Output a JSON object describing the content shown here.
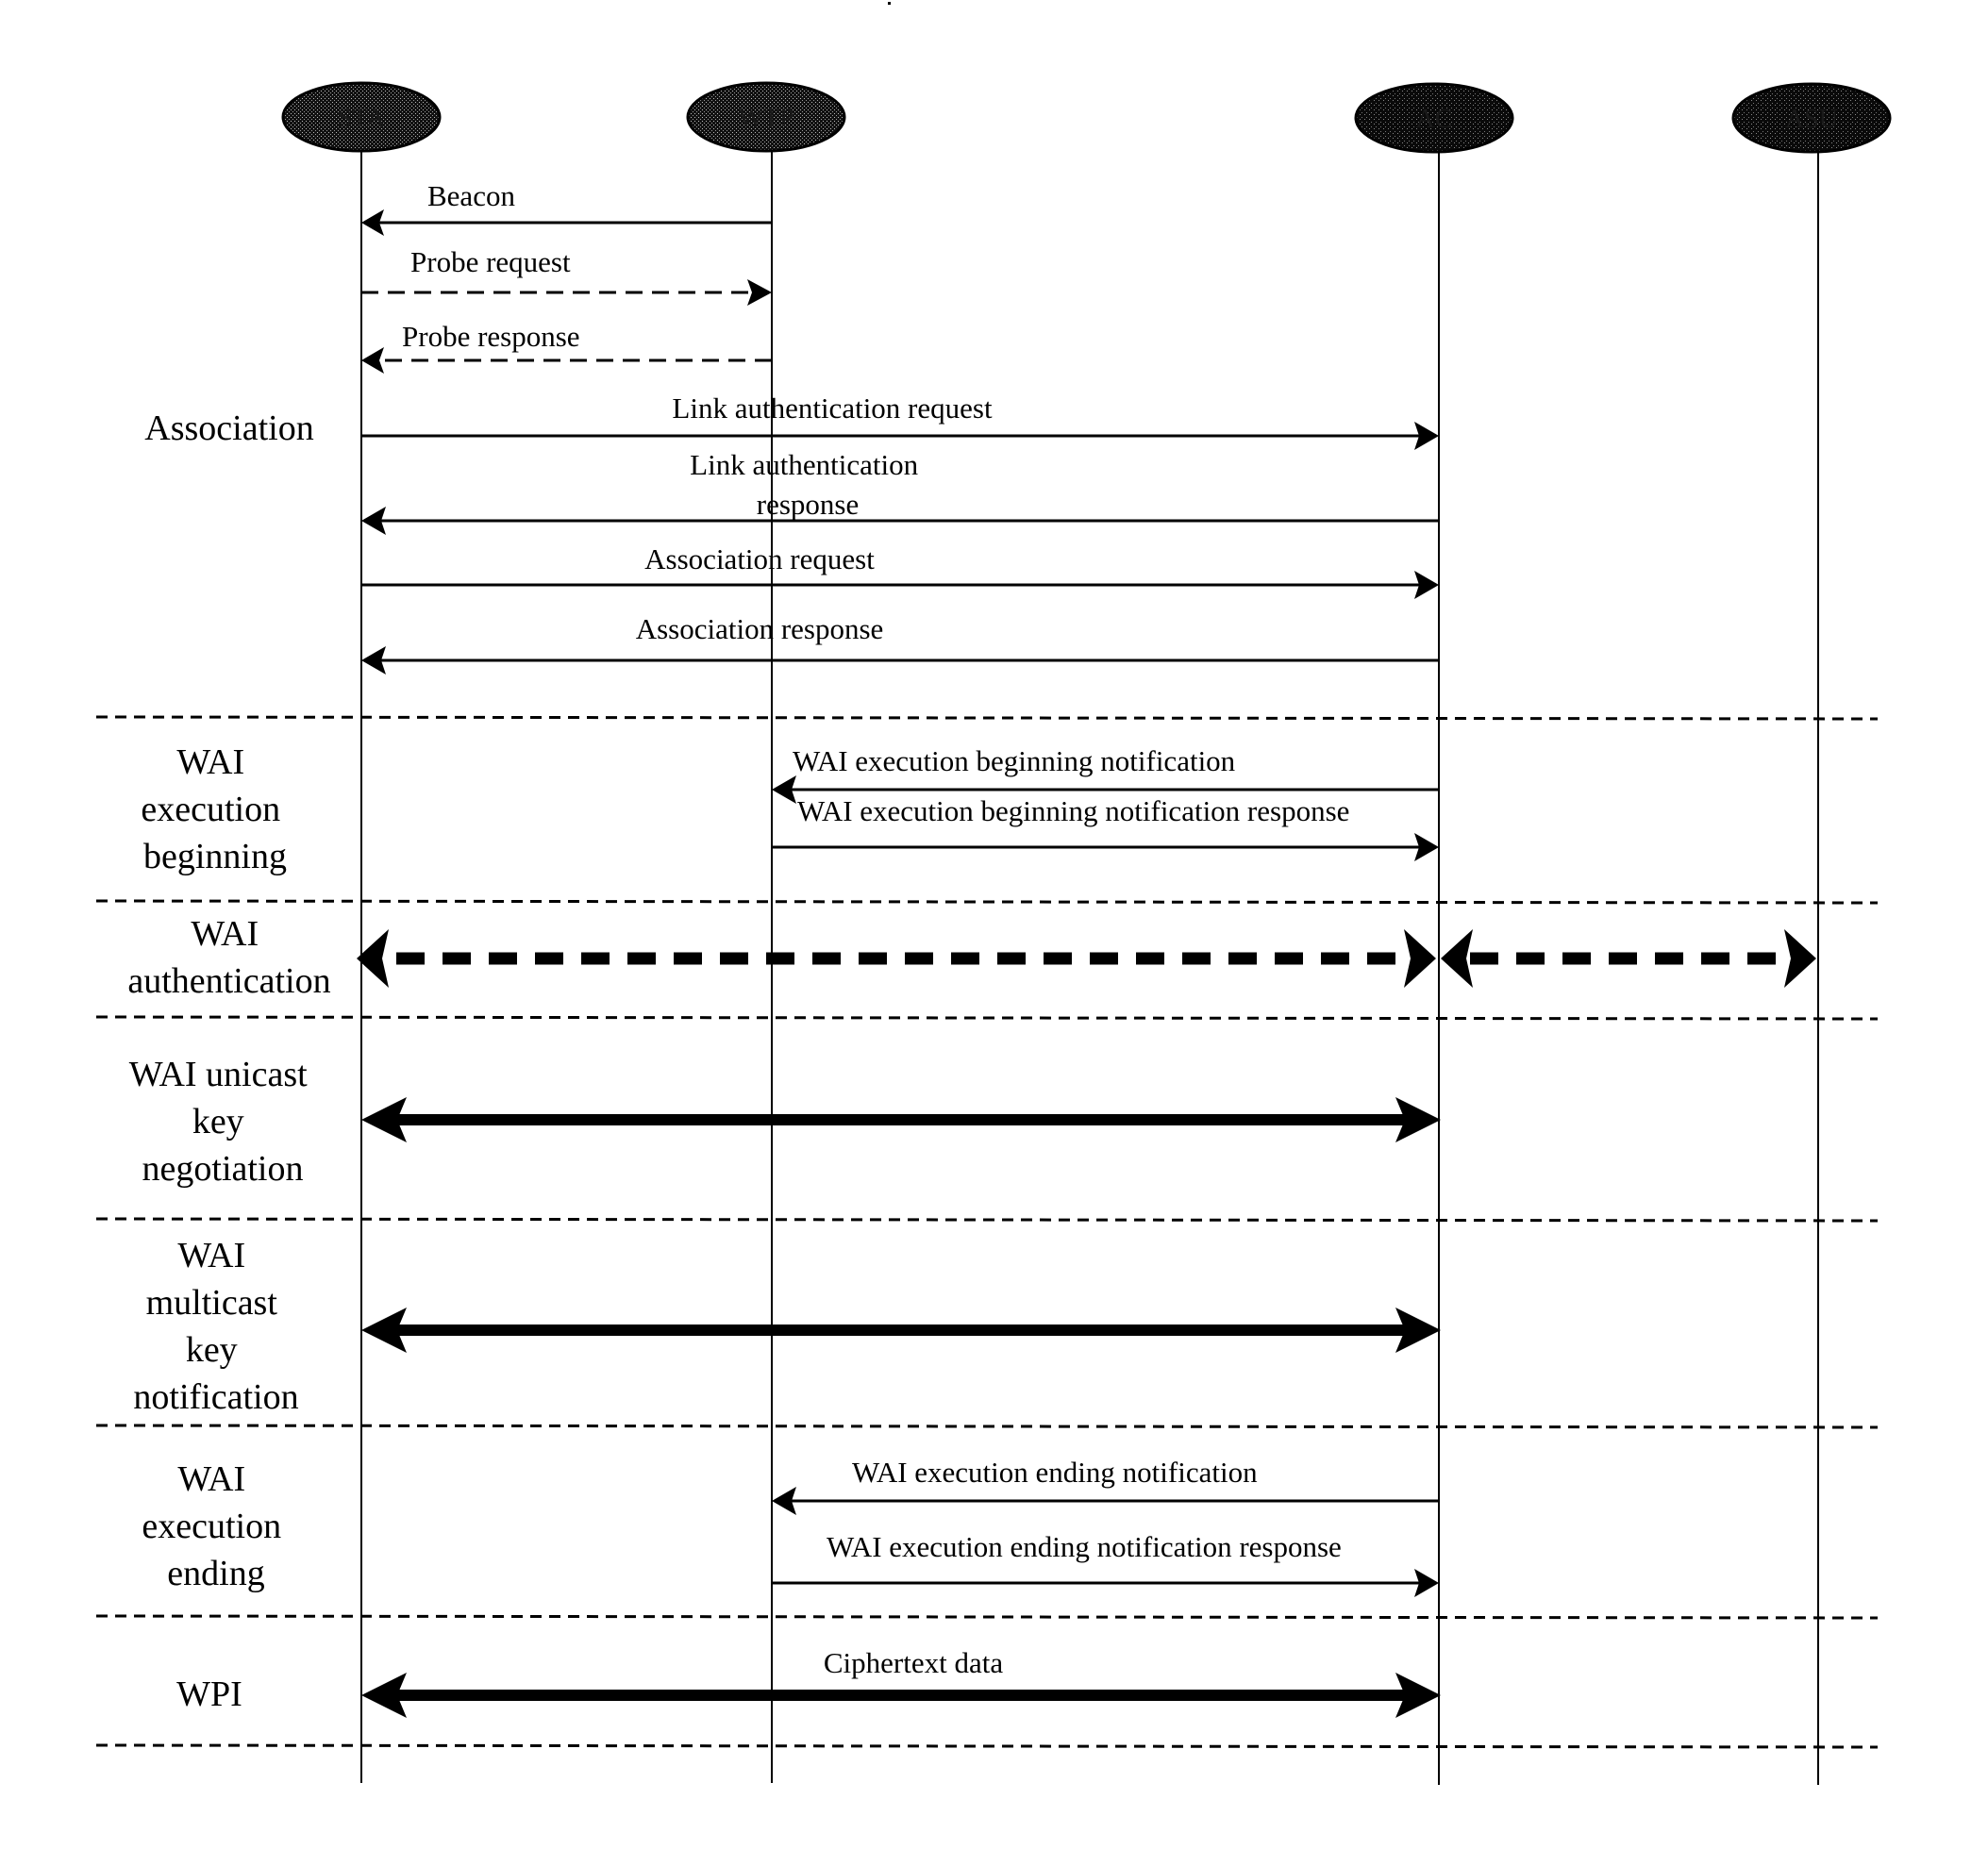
{
  "diagram": {
    "type": "sequence",
    "entities": [
      {
        "id": "sta",
        "label": "STA"
      },
      {
        "id": "wtp",
        "label": "WTP"
      },
      {
        "id": "ac",
        "label": "AC"
      },
      {
        "id": "asu",
        "label": "ASU"
      }
    ],
    "phases": [
      {
        "id": "association",
        "lines": [
          "Association"
        ]
      },
      {
        "id": "wai-execution-beginning",
        "lines": [
          "WAI",
          "execution",
          "beginning"
        ]
      },
      {
        "id": "wai-authentication",
        "lines": [
          "WAI",
          "authentication"
        ]
      },
      {
        "id": "wai-unicast-key-negotiation",
        "lines": [
          "WAI unicast",
          "key",
          "negotiation"
        ]
      },
      {
        "id": "wai-multicast-key-notification",
        "lines": [
          "WAI",
          "multicast",
          "key",
          "notification"
        ]
      },
      {
        "id": "wai-execution-ending",
        "lines": [
          "WAI",
          "execution",
          "ending"
        ]
      },
      {
        "id": "wpi",
        "lines": [
          "WPI"
        ]
      }
    ],
    "messages": [
      {
        "id": "beacon",
        "label": [
          "Beacon"
        ],
        "from": "wtp",
        "to": "sta",
        "style": "solid"
      },
      {
        "id": "probe-request",
        "label": [
          "Probe request"
        ],
        "from": "sta",
        "to": "wtp",
        "style": "dashed"
      },
      {
        "id": "probe-response",
        "label": [
          "Probe response"
        ],
        "from": "wtp",
        "to": "sta",
        "style": "dashed"
      },
      {
        "id": "link-authentication-request",
        "label": [
          "Link authentication request"
        ],
        "from": "sta",
        "to": "ac",
        "style": "solid"
      },
      {
        "id": "link-authentication-response",
        "label": [
          "Link authentication",
          "response"
        ],
        "from": "ac",
        "to": "sta",
        "style": "solid"
      },
      {
        "id": "association-request",
        "label": [
          "Association request"
        ],
        "from": "sta",
        "to": "ac",
        "style": "solid"
      },
      {
        "id": "association-response",
        "label": [
          "Association response"
        ],
        "from": "ac",
        "to": "sta",
        "style": "solid"
      },
      {
        "id": "wai-execution-beginning-notification",
        "label": [
          "WAI execution beginning notification"
        ],
        "from": "ac",
        "to": "wtp",
        "style": "solid"
      },
      {
        "id": "wai-execution-beginning-notification-response",
        "label": [
          "WAI execution beginning notification response"
        ],
        "from": "wtp",
        "to": "ac",
        "style": "solid"
      },
      {
        "id": "wai-authentication-sta-ac",
        "label": [],
        "from": "sta",
        "to": "ac",
        "style": "bold-dashed",
        "bidirectional": true
      },
      {
        "id": "wai-authentication-ac-asu",
        "label": [],
        "from": "ac",
        "to": "asu",
        "style": "bold-dashed",
        "bidirectional": true
      },
      {
        "id": "wai-unicast-key-negotiation",
        "label": [],
        "from": "sta",
        "to": "ac",
        "style": "bold",
        "bidirectional": true
      },
      {
        "id": "wai-multicast-key-notification",
        "label": [],
        "from": "sta",
        "to": "ac",
        "style": "bold",
        "bidirectional": true
      },
      {
        "id": "wai-execution-ending-notification",
        "label": [
          "WAI execution ending notification"
        ],
        "from": "ac",
        "to": "wtp",
        "style": "solid"
      },
      {
        "id": "wai-execution-ending-notification-response",
        "label": [
          "WAI execution ending notification response"
        ],
        "from": "wtp",
        "to": "ac",
        "style": "solid"
      },
      {
        "id": "ciphertext-data",
        "label": [
          "Ciphertext data"
        ],
        "from": "sta",
        "to": "ac",
        "style": "bold",
        "bidirectional": true
      }
    ]
  }
}
